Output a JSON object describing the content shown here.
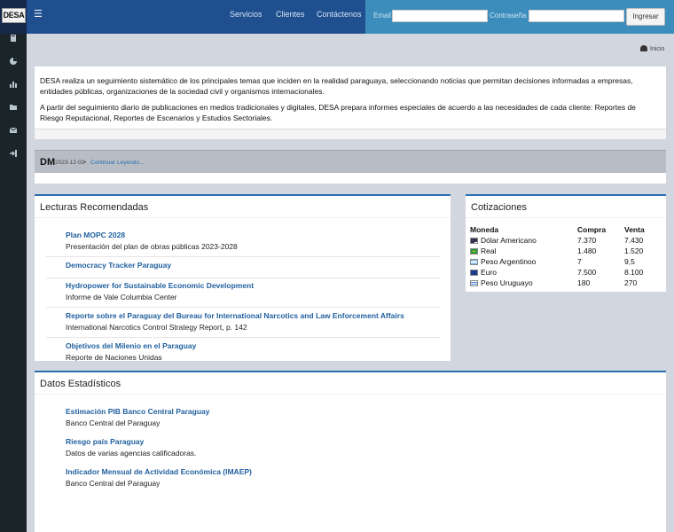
{
  "header": {
    "logo_text": "DESA",
    "nav": [
      "Servicios",
      "Clientes",
      "Contáctenos"
    ],
    "login": {
      "email_label": "Email",
      "password_label": "Contraseña",
      "button": "Ingresar"
    }
  },
  "breadcrumb": {
    "home": "Inicio"
  },
  "intro": {
    "p1": "DESA realiza un seguimiento sistemático de los principales temas que inciden en la realidad paraguaya, seleccionando noticias que permitan decisiones informadas a empresas, entidades públicas, organizaciones de la sociedad civil y organismos internacionales.",
    "p2": "A partir del seguimiento diario de publicaciones en medios tradicionales y digitales, DESA prepara informes especiales de acuerdo a las necesidades de cada cliente: Reportes de Riesgo Reputacional, Reportes de Escenarios y Estudios Sectoriales."
  },
  "dm": {
    "title": "DM",
    "date": "2023-12-03",
    "separator": "•",
    "more": "Continuar Leyendo..."
  },
  "lecturas": {
    "title": "Lecturas Recomendadas",
    "items": [
      {
        "title": "Plan MOPC 2028",
        "subtitle": "Presentación del plan de obras públicas 2023-2028"
      },
      {
        "title": "Democracy Tracker Paraguay",
        "subtitle": ""
      },
      {
        "title": "Hydropower for Sustainable Economic Development",
        "subtitle": "Informe de Vale Columbia Center"
      },
      {
        "title": "Reporte sobre el Paraguay del Bureau for International Narcotics and Law Enforcement Affairs",
        "subtitle": "International Narcotics Control Strategy Report, p. 142"
      },
      {
        "title": "Objetivos del Milenio en el Paraguay",
        "subtitle": "Reporte de Naciones Unidas"
      }
    ]
  },
  "cotizaciones": {
    "title": "Cotizaciones",
    "headers": [
      "Moneda",
      "Compra",
      "Venta"
    ],
    "rows": [
      {
        "currency": "Dólar Americano",
        "buy": "7.370",
        "sell": "7.430",
        "flag": "us-flag-icon"
      },
      {
        "currency": "Real",
        "buy": "1.480",
        "sell": "1.520",
        "flag": "brazil-flag-icon"
      },
      {
        "currency": "Peso Argentinoo",
        "buy": "7",
        "sell": "9,5",
        "flag": "argentina-flag-icon"
      },
      {
        "currency": "Euro",
        "buy": "7.500",
        "sell": "8.100",
        "flag": "eu-flag-icon"
      },
      {
        "currency": "Peso Uruguayo",
        "buy": "180",
        "sell": "270",
        "flag": "uruguay-flag-icon"
      }
    ]
  },
  "estadisticos": {
    "title": "Datos Estadísticos",
    "items": [
      {
        "title": "Estimación PIB Banco Central Paraguay",
        "subtitle": "Banco Central del Paraguay"
      },
      {
        "title": "Riesgo país Paraguay",
        "subtitle": "Datos de varias agencias calificadoras."
      },
      {
        "title": "Indicador Mensual de Actividad Económica (IMAEP)",
        "subtitle": "Banco Central del Paraguay"
      }
    ]
  },
  "sidebar_icons": [
    "book-icon",
    "pie-chart-icon",
    "bar-chart-icon",
    "folder-icon",
    "envelope-icon",
    "sign-in-icon"
  ],
  "colors": {
    "header_dark": "#1f4f8f",
    "header": "#3c8dbc",
    "sidebar": "#1b2429",
    "link": "#1f5f9f",
    "panel_accent": "#2a6fb0"
  }
}
